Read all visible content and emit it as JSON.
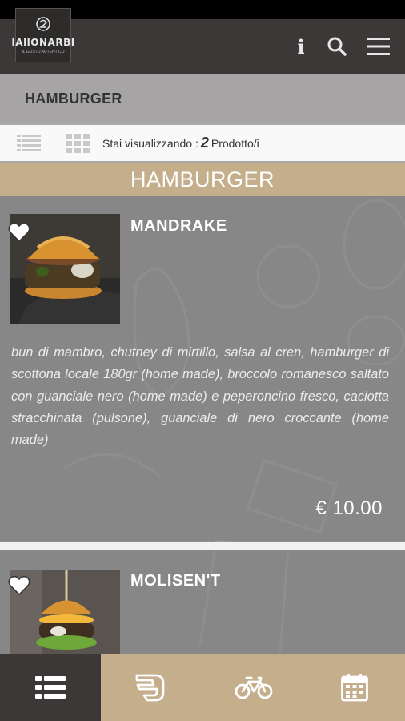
{
  "header": {
    "logo_text": "IAllONARBI",
    "logo_subtitle": "IL GUSTO AUTENTICO",
    "icons": [
      "info-icon",
      "search-icon",
      "hamburger-menu-icon"
    ]
  },
  "category_bar": {
    "title": "HAMBURGER"
  },
  "view_bar": {
    "label": "Stai visualizzando :",
    "count": "2",
    "unit": "Prodotto/i",
    "icons": [
      "list-view-icon",
      "grid-view-icon"
    ]
  },
  "section": {
    "title": "HAMBURGER"
  },
  "products": [
    {
      "name": "MANDRAKE",
      "description": "bun di mambro, chutney di mirtillo, salsa al cren, hamburger di scottona locale 180gr (home made), broccolo romanesco saltato con guanciale nero (home made) e peperoncino fresco, caciotta stracchinata (pulsone), guanciale di nero croccante (home made)",
      "price": "€ 10.00"
    },
    {
      "name": "MOLISEN'T"
    }
  ],
  "tabbar": {
    "tabs": [
      "menu-list-icon",
      "takeaway-icon",
      "delivery-bike-icon",
      "calendar-icon"
    ]
  },
  "colors": {
    "header_bg": "#3c3838",
    "accent_gold": "#c4ae8c",
    "category_bar_bg": "#a6a4a4",
    "content_bg": "#8f8f8f"
  }
}
